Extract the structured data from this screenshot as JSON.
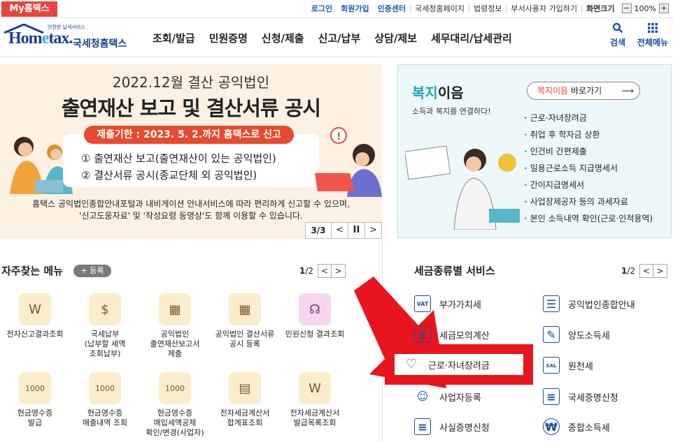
{
  "topbar": {
    "my_tab": "My홈택스",
    "links": [
      {
        "label": "로그인",
        "highlight": true
      },
      {
        "label": "회원가입",
        "highlight": true
      },
      {
        "label": "인증센터",
        "highlight": true
      },
      {
        "label": "국세청홈페이지",
        "highlight": false
      },
      {
        "label": "법령정보",
        "highlight": false
      },
      {
        "label": "부서사용자 가입하기",
        "highlight": false
      }
    ],
    "zoom_label": "화면크기",
    "zoom_value": "100%"
  },
  "header": {
    "logo_tiny": "안전한 납세서비스",
    "logo_home_a": "Hom",
    "logo_home_b": "e",
    "logo_home_c": "tax.",
    "logo_kr": "국세청홈택스",
    "menu": [
      "조회/발급",
      "민원증명",
      "신청/제출",
      "신고/납부",
      "상담/제보",
      "세무대리/납세관리"
    ],
    "search_label": "검색",
    "all_menu_label": "전체메뉴"
  },
  "banner": {
    "title1": "2022.12월 결산 공익법인",
    "title2": "출연재산 보고 및 결산서류 공시",
    "deadline": "제출기한 : 2023. 5. 2.까지 홈택스로 신고",
    "line1": "① 출연재산 보고(출연재산이 있는 공익법인)",
    "line2": "② 결산서류 공시(종교단체 외 공익법인)",
    "desc1": "홈택스 공익법인종합안내포털과 내비게이션 안내서비스에 따라 편리하게 신고할 수 있으며,",
    "desc2": "'신고도움자료' 및 '작성요령 동영상'도 함께 이용할 수 있습니다.",
    "page": "3/3",
    "prev": "<",
    "pause": "II",
    "next": ">",
    "accent": "#e84a2f"
  },
  "welfare": {
    "title_a": "복지",
    "title_b": "이음",
    "subtitle": "소득과 복지를 연결하다!",
    "go_a": "복지이음",
    "go_b": " 바로가기",
    "items": [
      "근로·자녀장려금",
      "취업 후 학자금 상환",
      "인건비 간편제출",
      "일용근로소득 지급명세서",
      "간이지급명세서",
      "사업장제공자 등의 과세자료",
      "본인 소득내역 확인(근로·인적용역)"
    ]
  },
  "favorites": {
    "title": "자주찾는 메뉴",
    "add": "+ 등록",
    "page_current": "1",
    "page_total": "/2",
    "items": [
      {
        "label": "전자신고결과조회",
        "icon": "W"
      },
      {
        "label": "국세납부\n(납부할 세액\n조회납부)",
        "icon": "$"
      },
      {
        "label": "공익법인\n출연재산보고서\n제출",
        "icon": "▦"
      },
      {
        "label": "공익법인 결산서류\n공시 등록",
        "icon": "▦"
      },
      {
        "label": "민원신청 결과조회",
        "icon": "☊"
      },
      {
        "label": "현금영수증\n발급",
        "icon": "1000"
      },
      {
        "label": "현금영수증\n매출내역 조회",
        "icon": "1000"
      },
      {
        "label": "현금영수증\n매입세액공제\n확인/변경(사업자)",
        "icon": "1000"
      },
      {
        "label": "전자세금계산서\n합계표조회",
        "icon": "▤"
      },
      {
        "label": "전자세금계산서\n발급목록조회",
        "icon": "W"
      }
    ]
  },
  "tax_services": {
    "title": "세금종류별 서비스",
    "page_current": "1",
    "page_total": "/2",
    "left": [
      {
        "label": "부가가치세",
        "icon": "VAT"
      },
      {
        "label": "세금모의계산",
        "icon": "±"
      },
      {
        "label": "근로·자녀장려금",
        "icon": "♡"
      },
      {
        "label": "사업자등록",
        "icon": "☺"
      },
      {
        "label": "사실증명신청",
        "icon": "≡"
      }
    ],
    "right": [
      {
        "label": "공익법인종합안내",
        "icon": "☰"
      },
      {
        "label": "양도소득세",
        "icon": "✎"
      },
      {
        "label": "원천세",
        "icon": "SAL"
      },
      {
        "label": "국세증명신청",
        "icon": "≡"
      },
      {
        "label": "종합소득세",
        "icon": "₩"
      }
    ]
  }
}
